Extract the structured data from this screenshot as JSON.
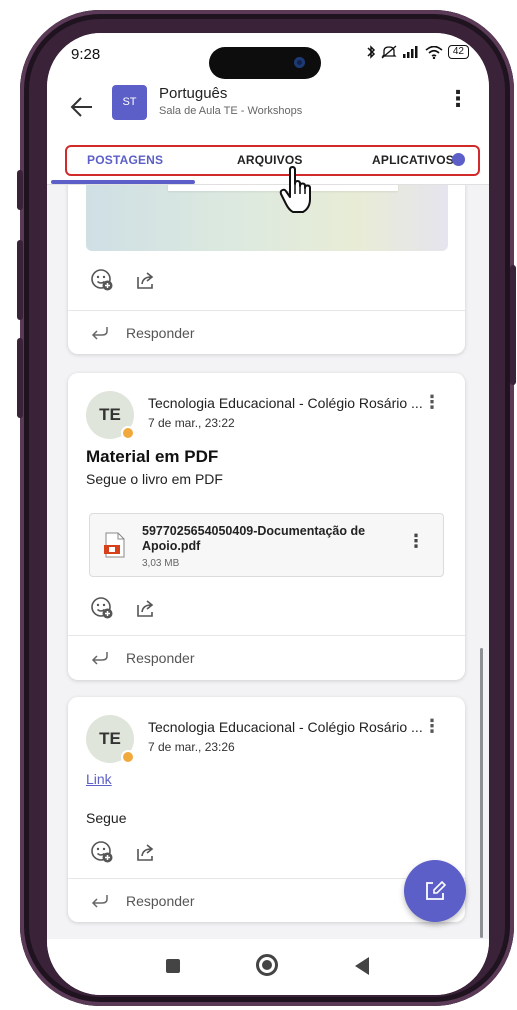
{
  "status_bar": {
    "time": "9:28",
    "battery": "42",
    "icons": [
      "bluetooth-icon",
      "mute-icon",
      "signal-icon",
      "wifi-icon",
      "battery-icon"
    ]
  },
  "header": {
    "team_initials": "ST",
    "channel_name": "Português",
    "team_name": "Sala de Aula TE - Workshops",
    "more_glyph": "⋮"
  },
  "tabs": [
    {
      "label": "POSTAGENS",
      "active": true
    },
    {
      "label": "ARQUIVOS",
      "active": false
    },
    {
      "label": "APLICATIVOS",
      "active": false
    }
  ],
  "posts": [
    {
      "reply_label": "Responder"
    },
    {
      "author_initials": "TE",
      "author": "Tecnologia Educacional - Colégio Rosário ...",
      "time": "7 de mar., 23:22",
      "title": "Material em PDF",
      "body": "Segue o livro em PDF",
      "attachment": {
        "name": "5977025654050409-Documentação de Apoio.pdf",
        "size": "3,03 MB"
      },
      "reply_label": "Responder"
    },
    {
      "author_initials": "TE",
      "author": "Tecnologia Educacional - Colégio Rosário ...",
      "time": "7 de mar., 23:26",
      "link": "Link",
      "body": "Segue",
      "reply_label": "Responder"
    }
  ],
  "colors": {
    "accent": "#5b5fc7",
    "highlight_border": "#d12a2a",
    "phone_frame": "#3a2338"
  }
}
